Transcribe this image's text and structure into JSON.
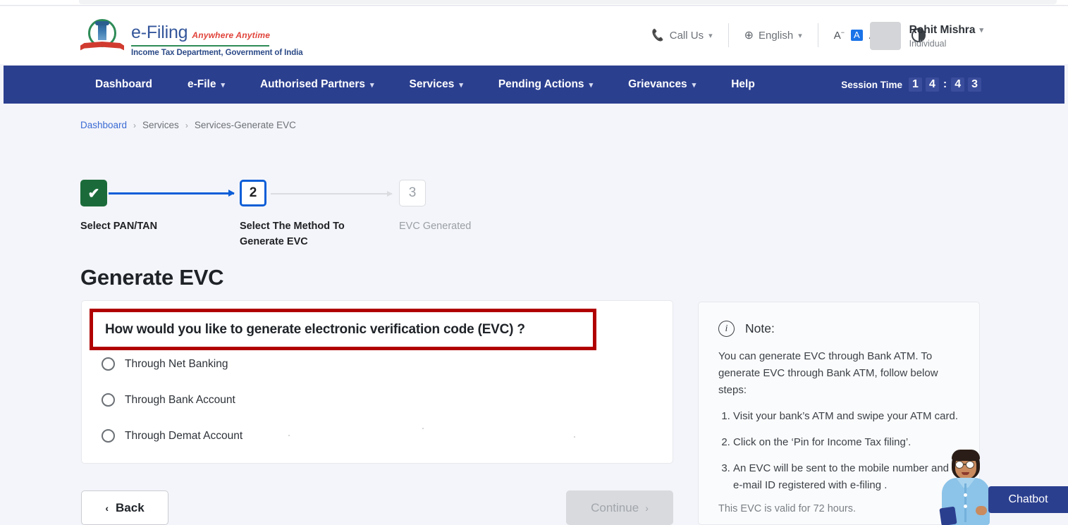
{
  "brand": {
    "name": "e-Filing",
    "tagline": "Anywhere Anytime",
    "subtitle": "Income Tax Department, Government of India",
    "emblem_icon": "india-national-emblem-icon"
  },
  "header": {
    "call_us": "Call Us",
    "language": "English",
    "font_decrease": "A",
    "font_normal": "A",
    "font_increase": "A",
    "contrast_icon": "contrast-icon",
    "user": {
      "name": "Rohit Mishra",
      "role": "Individual"
    }
  },
  "nav": {
    "items": [
      {
        "label": "Dashboard",
        "has_dropdown": false
      },
      {
        "label": "e-File",
        "has_dropdown": true
      },
      {
        "label": "Authorised Partners",
        "has_dropdown": true
      },
      {
        "label": "Services",
        "has_dropdown": true
      },
      {
        "label": "Pending Actions",
        "has_dropdown": true
      },
      {
        "label": "Grievances",
        "has_dropdown": true
      },
      {
        "label": "Help",
        "has_dropdown": false
      }
    ],
    "session": {
      "label": "Session Time",
      "d1": "1",
      "d2": "4",
      "colon": ":",
      "d3": "4",
      "d4": "3"
    }
  },
  "breadcrumb": {
    "item1": "Dashboard",
    "sep1": "›",
    "item2": "Services",
    "sep2": "›",
    "item3": "Services-Generate EVC"
  },
  "stepper": {
    "step1": {
      "indicator": "✔",
      "label": "Select PAN/TAN",
      "state": "completed"
    },
    "step2": {
      "indicator": "2",
      "label": "Select The Method To Generate EVC",
      "state": "current"
    },
    "step3": {
      "indicator": "3",
      "label": "EVC Generated",
      "state": "upcoming"
    }
  },
  "main": {
    "title": "Generate EVC",
    "question": "How would you like to generate electronic verification code (EVC) ?",
    "options": [
      {
        "label": "Through Net Banking",
        "selected": false
      },
      {
        "label": "Through Bank Account",
        "selected": false
      },
      {
        "label": "Through Demat Account",
        "selected": false
      }
    ]
  },
  "note": {
    "icon": "info-icon",
    "title": "Note:",
    "intro": "You can generate EVC through Bank ATM. To generate EVC through Bank ATM, follow below steps:",
    "steps": [
      "Visit your bank’s ATM and swipe your ATM card.",
      "Click on the ‘Pin for Income Tax filing’.",
      "An EVC will be sent to the mobile number and e-mail ID registered with e-filing ."
    ],
    "validity": "This EVC is valid for 72 hours."
  },
  "footer": {
    "back_label": "Back",
    "back_chevron": "‹",
    "continue_label": "Continue",
    "continue_chevron": "›",
    "continue_disabled": true
  },
  "chatbot": {
    "label": "Chatbot",
    "avatar_icon": "chatbot-agent-avatar-icon"
  },
  "colors": {
    "nav_blue": "#2b3f8f",
    "accent_blue": "#0b5ed7",
    "step_done_green": "#1b6b3a",
    "highlight_red": "#b00000",
    "page_bg": "#f4f5fa",
    "brand_text": "#34569b",
    "tagline_red": "#e0433a"
  }
}
